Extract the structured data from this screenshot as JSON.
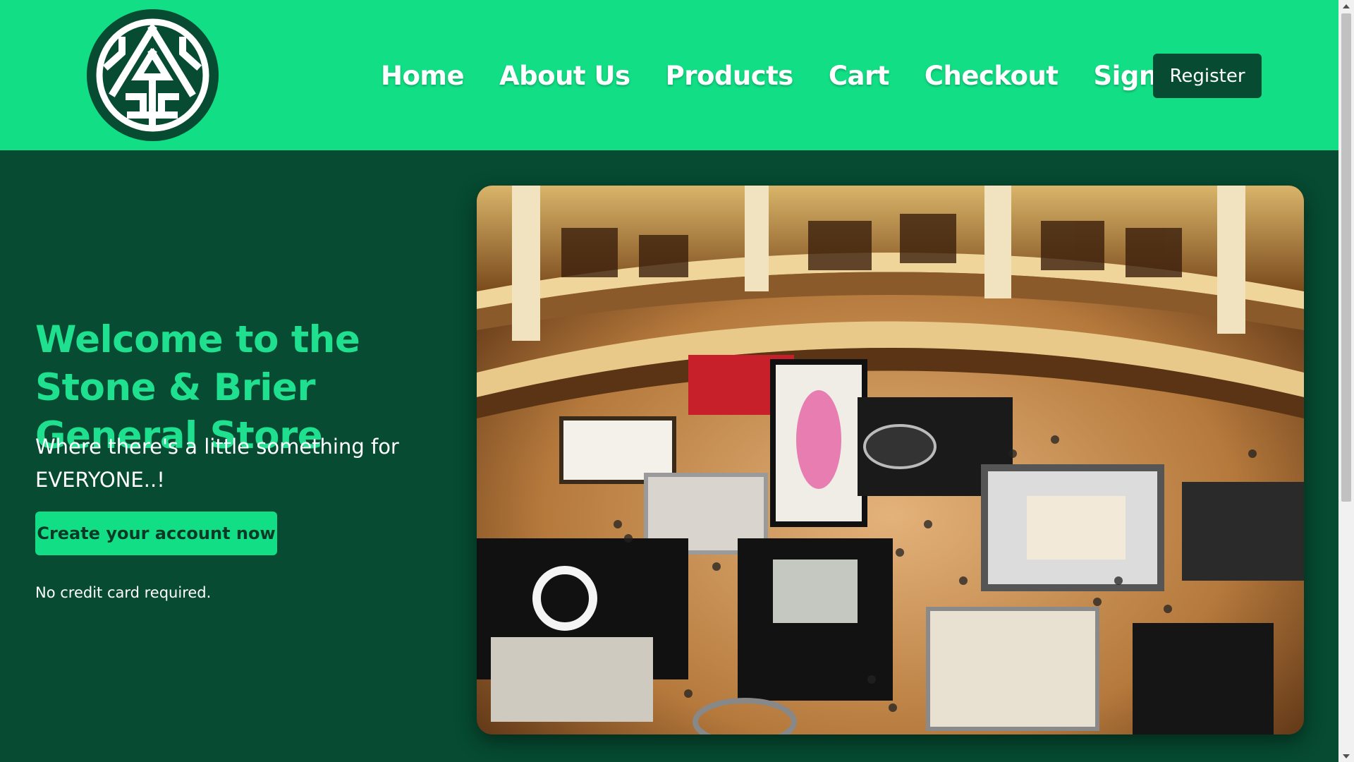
{
  "brand": {
    "logo_icon": "triangle-knot-emblem-icon",
    "primary_color": "#12df85",
    "dark_color": "#064b32"
  },
  "nav": {
    "links": [
      "Home",
      "About Us",
      "Products",
      "Cart",
      "Checkout",
      "Sign-In"
    ],
    "register_label": "Register"
  },
  "hero": {
    "title": "Welcome to the Stone & Brier General Store",
    "subtitle": "Where there's a little something for EVERYONE..!",
    "cta_label": "Create your account now",
    "note": "No credit card required.",
    "image_icon": "department-store-atrium-photo"
  },
  "scrollbar": {
    "up_icon": "scroll-up-arrow-icon",
    "down_icon": "scroll-down-arrow-icon"
  }
}
